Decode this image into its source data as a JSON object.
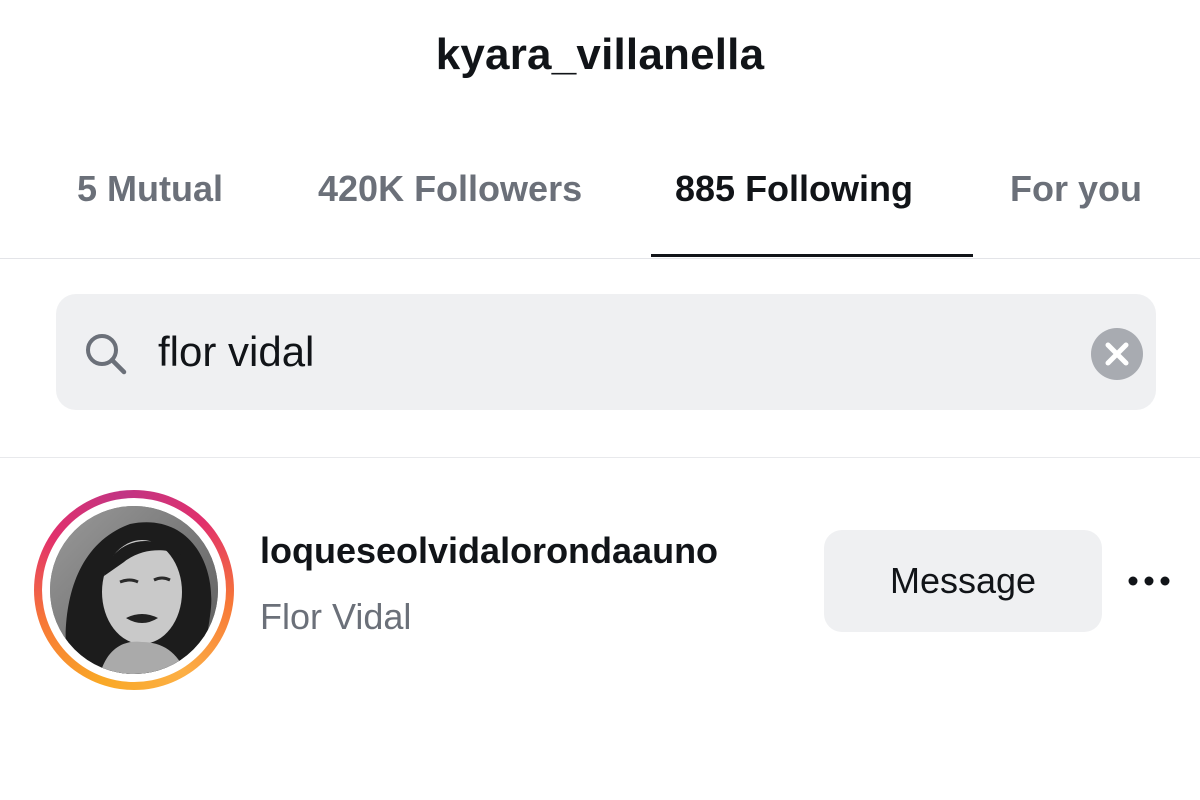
{
  "header": {
    "title": "kyara_villanella"
  },
  "tabs": [
    {
      "label": "5 Mutual",
      "active": false
    },
    {
      "label": "420K Followers",
      "active": false
    },
    {
      "label": "885 Following",
      "active": true
    },
    {
      "label": "For you",
      "active": false
    }
  ],
  "search": {
    "value": "flor vidal",
    "icon": "search-icon",
    "clear_icon": "close-icon"
  },
  "results": [
    {
      "username": "loqueseolvidalorondaauno",
      "full_name": "Flor Vidal",
      "has_story_ring": true,
      "button_label": "Message",
      "more_icon": "more-horizontal-icon"
    }
  ],
  "colors": {
    "text_primary": "#111418",
    "text_secondary": "#6b7079",
    "field_background": "#eff0f2",
    "story_ring_start": "#f9a826",
    "story_ring_end": "#c13584"
  }
}
